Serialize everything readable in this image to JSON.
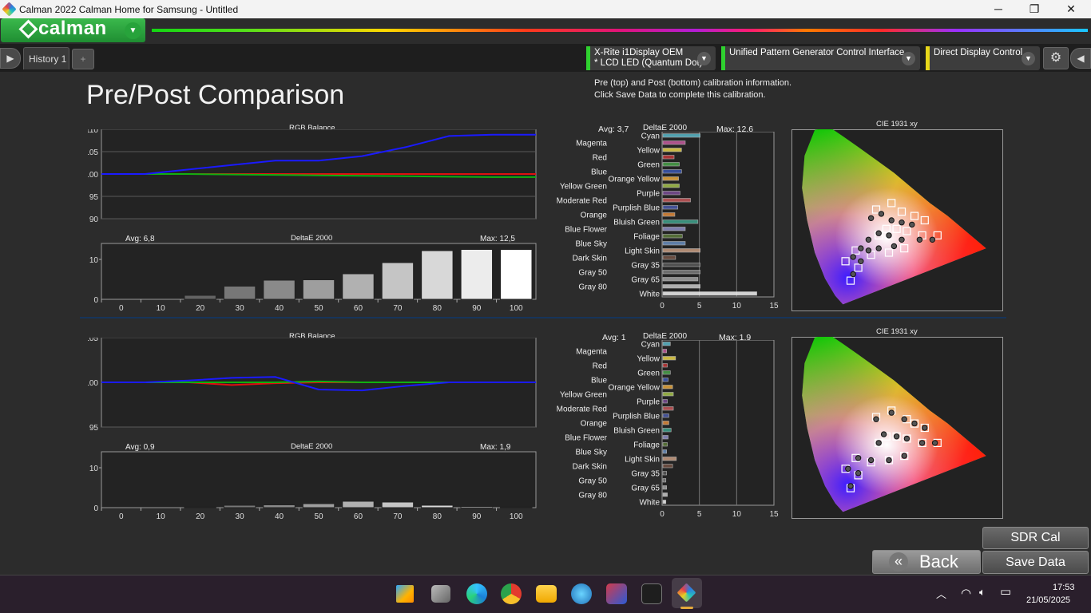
{
  "window": {
    "title": "Calman 2022 Calman Home for Samsung  - Untitled",
    "minimize_glyph": "─",
    "restore_glyph": "❐",
    "close_glyph": "✕"
  },
  "app": {
    "logo_text": "calman",
    "logo_dropdown_glyph": "▼"
  },
  "tabs": {
    "history_label": "History 1",
    "add_glyph": "+",
    "left_arrow_glyph": "▶",
    "right_arrow_glyph": "◀",
    "gear_glyph": "⚙"
  },
  "devices": [
    {
      "line1": "X-Rite i1Display OEM",
      "line2": "* LCD LED (Quantum Dot)",
      "color": "#2fd12f"
    },
    {
      "line1": "Unified Pattern Generator Control Interface",
      "line2": "",
      "color": "#2fd12f"
    },
    {
      "line1": "Direct Display Control",
      "line2": "",
      "color": "#e8d81a"
    }
  ],
  "page": {
    "title": "Pre/Post Comparison",
    "info_line1": "Pre (top) and Post (bottom) calibration information.",
    "info_line2": "Click Save Data to complete this calibration."
  },
  "pre": {
    "rgb_title": "RGB Balance",
    "rgb_yticks": [
      "110",
      "105",
      "100",
      "95",
      "90"
    ],
    "de_title": "DeltaE 2000",
    "de_avg": "Avg: 6,8",
    "de_max": "Max: 12,5",
    "de_ytick": "10",
    "de_yzero": "0",
    "colors_title": "DeltaE 2000",
    "colors_avg": "Avg: 3,7",
    "colors_max": "Max: 12,6",
    "cie_title": "CIE 1931 xy"
  },
  "post": {
    "rgb_title": "RGB Balance",
    "rgb_yticks": [
      "105",
      "100",
      "95"
    ],
    "de_title": "DeltaE 2000",
    "de_avg": "Avg: 0,9",
    "de_max": "Max: 1,9",
    "de_ytick": "10",
    "de_yzero": "0",
    "colors_title": "DeltaE 2000",
    "colors_avg": "Avg: 1",
    "colors_max": "Max: 1,9",
    "cie_title": "CIE 1931 xy"
  },
  "chart_data": [
    {
      "type": "line",
      "name": "pre-rgb-balance",
      "title": "RGB Balance",
      "x": [
        0,
        10,
        20,
        30,
        40,
        50,
        60,
        70,
        80,
        90,
        100
      ],
      "ylim": [
        90,
        110
      ],
      "series": [
        {
          "color": "#e01010",
          "values": [
            100,
            100,
            100,
            100,
            100,
            100,
            100,
            100,
            100,
            100,
            100
          ]
        },
        {
          "color": "#10b010",
          "values": [
            100,
            100,
            100,
            99.9,
            99.8,
            99.7,
            99.6,
            99.5,
            99.4,
            99.3,
            99.3
          ]
        },
        {
          "color": "#1a1aff",
          "values": [
            100,
            100,
            101,
            102,
            103,
            103,
            104,
            106,
            108.5,
            108.8,
            108.8
          ]
        }
      ]
    },
    {
      "type": "bar",
      "name": "pre-grayscale-deltae",
      "title": "DeltaE 2000",
      "categories": [
        "0",
        "10",
        "20",
        "30",
        "40",
        "50",
        "60",
        "70",
        "80",
        "90",
        "100"
      ],
      "values": [
        0,
        0,
        1,
        3.3,
        4.8,
        4.9,
        6.4,
        9.2,
        12.2,
        12.5,
        12.5
      ],
      "ylim": [
        0,
        14
      ]
    },
    {
      "type": "bar",
      "name": "pre-colorchecker-deltae",
      "title": "DeltaE 2000",
      "xticks": [
        "0",
        "5",
        "10",
        "15"
      ],
      "xlim": [
        0,
        15
      ],
      "categories": [
        "Cyan",
        "Magenta",
        "Yellow",
        "Red",
        "Green",
        "Blue",
        "Orange Yellow",
        "Yellow Green",
        "Purple",
        "Moderate Red",
        "Purplish Blue",
        "Orange",
        "Bluish Green",
        "Blue Flower",
        "Foliage",
        "Blue Sky",
        "Light Skin",
        "Dark Skin",
        "Gray 35",
        "Gray 50",
        "Gray 65",
        "Gray 80",
        "White"
      ],
      "values": [
        5,
        3,
        2.5,
        1.5,
        2.2,
        2.5,
        2.1,
        2.2,
        2.3,
        3.7,
        2,
        1.6,
        4.7,
        3,
        2.6,
        3,
        5,
        1.7,
        5,
        5,
        4.7,
        5,
        12.6
      ]
    },
    {
      "type": "line",
      "name": "post-rgb-balance",
      "title": "RGB Balance",
      "x": [
        0,
        10,
        20,
        30,
        40,
        50,
        60,
        70,
        80,
        90,
        100
      ],
      "ylim": [
        95,
        105
      ],
      "series": [
        {
          "color": "#e01010",
          "values": [
            100,
            100,
            100,
            99.7,
            99.9,
            100,
            100,
            100,
            100,
            100,
            100
          ]
        },
        {
          "color": "#10b010",
          "values": [
            100,
            100,
            100,
            100,
            100,
            100.1,
            100,
            100,
            100,
            100,
            100
          ]
        },
        {
          "color": "#1a1aff",
          "values": [
            100,
            100,
            100.2,
            100.5,
            100.6,
            99.2,
            99.1,
            99.6,
            100,
            100,
            100
          ]
        }
      ]
    },
    {
      "type": "bar",
      "name": "post-grayscale-deltae",
      "title": "DeltaE 2000",
      "categories": [
        "0",
        "10",
        "20",
        "30",
        "40",
        "50",
        "60",
        "70",
        "80",
        "90",
        "100"
      ],
      "values": [
        0,
        0,
        0.2,
        0.6,
        0.7,
        1,
        1.6,
        1.4,
        0.6,
        0.3,
        0.2
      ],
      "ylim": [
        0,
        14
      ]
    },
    {
      "type": "bar",
      "name": "post-colorchecker-deltae",
      "title": "DeltaE 2000",
      "xticks": [
        "0",
        "5",
        "10",
        "15"
      ],
      "xlim": [
        0,
        15
      ],
      "categories": [
        "Cyan",
        "Magenta",
        "Yellow",
        "Red",
        "Green",
        "Blue",
        "Orange Yellow",
        "Yellow Green",
        "Purple",
        "Moderate Red",
        "Purplish Blue",
        "Orange",
        "Bluish Green",
        "Blue Flower",
        "Foliage",
        "Blue Sky",
        "Light Skin",
        "Dark Skin",
        "Gray 35",
        "Gray 50",
        "Gray 65",
        "Gray 80",
        "White"
      ],
      "values": [
        1,
        0.5,
        1.7,
        0.6,
        1,
        0.7,
        1.3,
        1.4,
        0.6,
        1.4,
        0.8,
        0.8,
        1.1,
        0.7,
        0.6,
        0.5,
        1.8,
        1.3,
        0.5,
        0.4,
        0.5,
        0.6,
        0.4
      ]
    },
    {
      "type": "scatter",
      "name": "pre-cie",
      "title": "CIE 1931 xy",
      "targets": [
        [
          0.3,
          0.45
        ],
        [
          0.36,
          0.48
        ],
        [
          0.4,
          0.44
        ],
        [
          0.45,
          0.42
        ],
        [
          0.49,
          0.4
        ],
        [
          0.34,
          0.36
        ],
        [
          0.38,
          0.36
        ],
        [
          0.42,
          0.35
        ],
        [
          0.48,
          0.33
        ],
        [
          0.54,
          0.33
        ],
        [
          0.31,
          0.33
        ],
        [
          0.22,
          0.26
        ],
        [
          0.28,
          0.24
        ],
        [
          0.35,
          0.25
        ],
        [
          0.41,
          0.27
        ],
        [
          0.18,
          0.21
        ],
        [
          0.23,
          0.18
        ],
        [
          0.2,
          0.12
        ]
      ],
      "measured": [
        [
          0.28,
          0.41
        ],
        [
          0.32,
          0.43
        ],
        [
          0.36,
          0.4
        ],
        [
          0.4,
          0.39
        ],
        [
          0.44,
          0.38
        ],
        [
          0.31,
          0.34
        ],
        [
          0.35,
          0.33
        ],
        [
          0.4,
          0.31
        ],
        [
          0.47,
          0.31
        ],
        [
          0.52,
          0.31
        ],
        [
          0.27,
          0.31
        ],
        [
          0.24,
          0.27
        ],
        [
          0.27,
          0.26
        ],
        [
          0.31,
          0.27
        ],
        [
          0.37,
          0.28
        ],
        [
          0.21,
          0.23
        ],
        [
          0.24,
          0.21
        ],
        [
          0.21,
          0.15
        ]
      ]
    },
    {
      "type": "scatter",
      "name": "post-cie",
      "title": "CIE 1931 xy",
      "targets": [
        [
          0.3,
          0.45
        ],
        [
          0.36,
          0.48
        ],
        [
          0.42,
          0.44
        ],
        [
          0.45,
          0.42
        ],
        [
          0.49,
          0.4
        ],
        [
          0.34,
          0.36
        ],
        [
          0.38,
          0.36
        ],
        [
          0.42,
          0.35
        ],
        [
          0.48,
          0.33
        ],
        [
          0.54,
          0.33
        ],
        [
          0.31,
          0.33
        ],
        [
          0.22,
          0.26
        ],
        [
          0.28,
          0.24
        ],
        [
          0.35,
          0.25
        ],
        [
          0.41,
          0.27
        ],
        [
          0.18,
          0.21
        ],
        [
          0.23,
          0.18
        ],
        [
          0.2,
          0.12
        ]
      ],
      "measured": [
        [
          0.3,
          0.44
        ],
        [
          0.36,
          0.47
        ],
        [
          0.41,
          0.44
        ],
        [
          0.45,
          0.42
        ],
        [
          0.49,
          0.4
        ],
        [
          0.33,
          0.37
        ],
        [
          0.38,
          0.36
        ],
        [
          0.42,
          0.35
        ],
        [
          0.48,
          0.33
        ],
        [
          0.53,
          0.33
        ],
        [
          0.31,
          0.33
        ],
        [
          0.23,
          0.26
        ],
        [
          0.28,
          0.25
        ],
        [
          0.35,
          0.25
        ],
        [
          0.41,
          0.27
        ],
        [
          0.19,
          0.21
        ],
        [
          0.23,
          0.19
        ],
        [
          0.2,
          0.13
        ]
      ]
    }
  ],
  "buttons": {
    "sdr_cal": "SDR Cal",
    "back": "Back",
    "back_glyph": "«",
    "save_data": "Save Data"
  },
  "taskbar": {
    "time": "17:53",
    "date": "21/05/2025",
    "chevron_glyph": "︿",
    "wifi_glyph": "◠",
    "volume_glyph": "🔈︎",
    "battery_glyph": "▭"
  }
}
